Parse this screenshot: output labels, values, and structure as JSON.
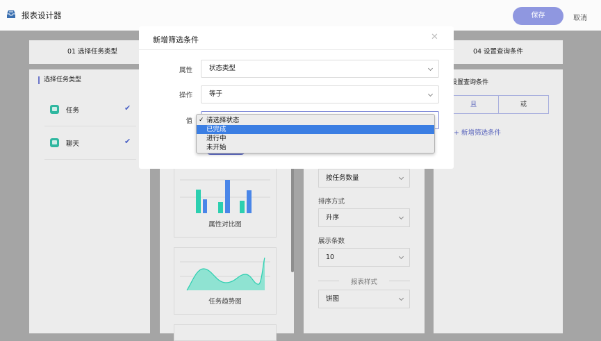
{
  "header": {
    "app_icon": "inbox-tray-icon",
    "title": "报表设计器",
    "save_label": "保存",
    "cancel_label": "取消"
  },
  "steps": [
    {
      "label": "01 选择任务类型"
    },
    {
      "label": "04 设置查询条件"
    }
  ],
  "task_types": {
    "title": "选择任务类型",
    "items": [
      {
        "label": "任务",
        "icon": "task-icon",
        "checked": true
      },
      {
        "label": "聊天",
        "icon": "chat-icon",
        "checked": true
      }
    ]
  },
  "chart_styles": [
    {
      "caption": "属性对比图",
      "icon": "bar-chart-icon"
    },
    {
      "caption": "任务趋势图",
      "icon": "area-chart-icon"
    }
  ],
  "settings": {
    "group_by_value": "按任务数量",
    "sort_label": "排序方式",
    "sort_value": "升序",
    "count_label": "展示条数",
    "count_value": "10",
    "style_divider": "报表样式",
    "style_value": "饼图"
  },
  "query": {
    "title": "设置查询条件",
    "logic_and": "且",
    "logic_or": "或",
    "add_filter": "+ 新增筛选条件"
  },
  "modal": {
    "title": "新增筛选条件",
    "close_icon": "close-icon",
    "attribute_label": "属性",
    "attribute_value": "状态类型",
    "operator_label": "操作",
    "operator_value": "等于",
    "value_label": "值"
  },
  "dropdown": {
    "options": [
      {
        "label": "请选择状态",
        "checked": true,
        "highlighted": false
      },
      {
        "label": "已完成",
        "checked": false,
        "highlighted": true
      },
      {
        "label": "进行中",
        "checked": false,
        "highlighted": false
      },
      {
        "label": "未开始",
        "checked": false,
        "highlighted": false
      }
    ]
  },
  "colors": {
    "accent": "#5b66bd",
    "save_button": "#8f97e0",
    "chart_teal": "#2ccfb0",
    "chart_blue": "#4a86e8",
    "highlight": "#3b7ee3"
  }
}
